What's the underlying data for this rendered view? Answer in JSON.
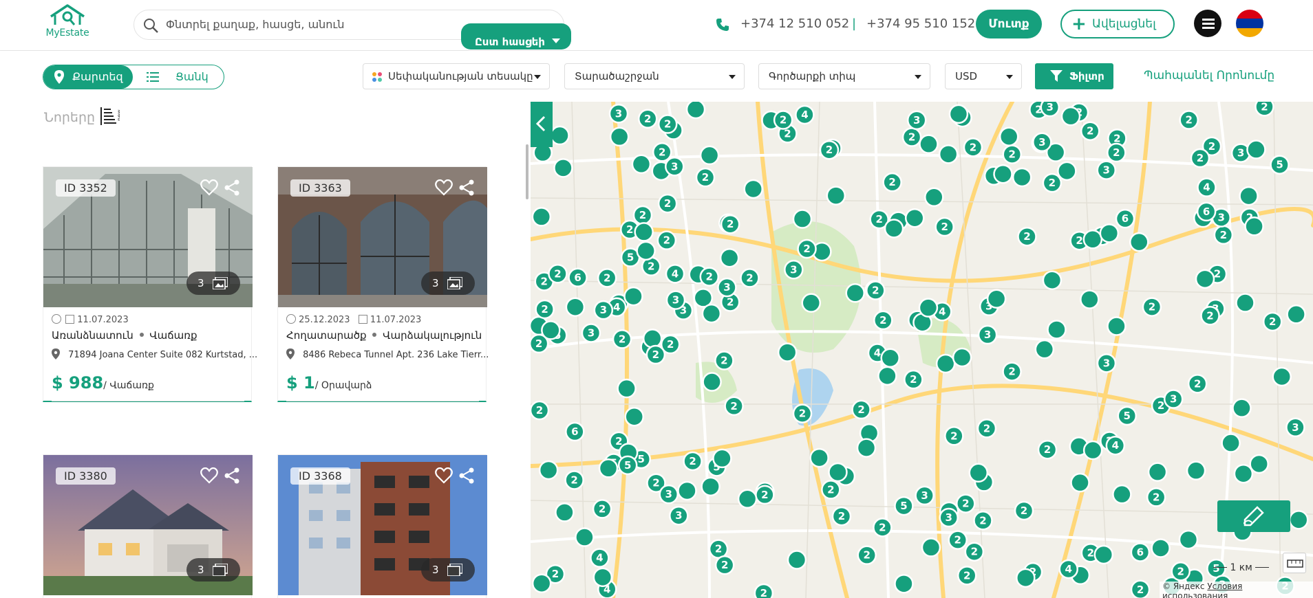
{
  "header": {
    "logo_text": "MyEstate",
    "search_placeholder": "Փնտրել քաղաք, հասցե, անուն",
    "advanced_search": "Ըստ հասցեի",
    "phone1": "+374 12 510 052",
    "separator": "|",
    "phone2": "+374 95 510 152",
    "login": "Մուտք",
    "add": "Ավելացնել",
    "accent": "#16a07d"
  },
  "filters": {
    "map_label": "Քարտեզ",
    "list_label": "Ցանկ",
    "property_type": "Սեփականության տեսակը",
    "region": "Տարածաշրջան",
    "deal_type": "Գործարքի տիպ",
    "currency": "USD",
    "filter_button": "Ֆիլտր",
    "save_search": "Պահպանել Որոնումը"
  },
  "listing": {
    "sort_label": "Նորերը",
    "cards": [
      {
        "id": "ID 3352",
        "photos": "3",
        "date_updated": "",
        "date_created": "11.07.2023",
        "type": "Առանձնատուն",
        "deal": "Վաճառք",
        "address": "71894 Joana Center Suite 082 Kurtstad, ...",
        "price": "$ 988",
        "price_unit": "/ Վաճառք"
      },
      {
        "id": "ID 3363",
        "photos": "3",
        "date_updated": "25.12.2023",
        "date_created": "11.07.2023",
        "type": "Հողատարածք",
        "deal": "Վարձակալություն",
        "address": "8486 Rebeca Tunnel Apt. 236 Lake Tierr...",
        "price": "$ 1",
        "price_unit": "/ Օրավարձ"
      },
      {
        "id": "ID 3380",
        "photos": "3"
      },
      {
        "id": "ID 3368",
        "photos": "3"
      }
    ]
  },
  "map": {
    "copyright": "© Яндекс",
    "terms": "Условия использования",
    "scale": "1 км",
    "marker_labels": [
      "2",
      "3",
      "4",
      "5",
      "6",
      "8"
    ]
  }
}
